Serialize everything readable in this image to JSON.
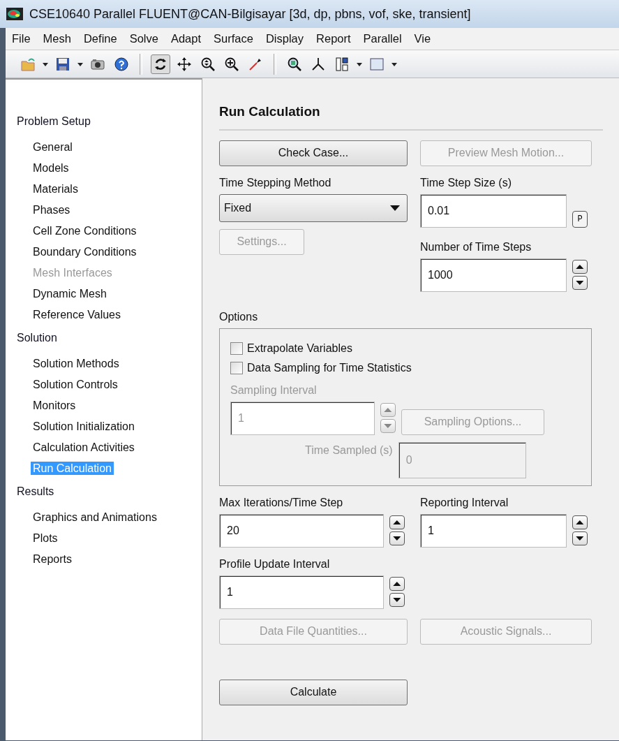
{
  "window": {
    "title": "CSE10640 Parallel FLUENT@CAN-Bilgisayar  [3d, dp, pbns, vof, ske, transient]"
  },
  "menu_bar": [
    "File",
    "Mesh",
    "Define",
    "Solve",
    "Adapt",
    "Surface",
    "Display",
    "Report",
    "Parallel",
    "Vie"
  ],
  "navigation": [
    {
      "label": "Problem Setup",
      "items": [
        {
          "label": "General",
          "disabled": false,
          "selected": false
        },
        {
          "label": "Models",
          "disabled": false,
          "selected": false
        },
        {
          "label": "Materials",
          "disabled": false,
          "selected": false
        },
        {
          "label": "Phases",
          "disabled": false,
          "selected": false
        },
        {
          "label": "Cell Zone Conditions",
          "disabled": false,
          "selected": false
        },
        {
          "label": "Boundary Conditions",
          "disabled": false,
          "selected": false
        },
        {
          "label": "Mesh Interfaces",
          "disabled": true,
          "selected": false
        },
        {
          "label": "Dynamic Mesh",
          "disabled": false,
          "selected": false
        },
        {
          "label": "Reference Values",
          "disabled": false,
          "selected": false
        }
      ]
    },
    {
      "label": "Solution",
      "items": [
        {
          "label": "Solution Methods",
          "disabled": false,
          "selected": false
        },
        {
          "label": "Solution Controls",
          "disabled": false,
          "selected": false
        },
        {
          "label": "Monitors",
          "disabled": false,
          "selected": false
        },
        {
          "label": "Solution Initialization",
          "disabled": false,
          "selected": false
        },
        {
          "label": "Calculation Activities",
          "disabled": false,
          "selected": false
        },
        {
          "label": "Run Calculation",
          "disabled": false,
          "selected": true
        }
      ]
    },
    {
      "label": "Results",
      "items": [
        {
          "label": "Graphics and Animations",
          "disabled": false,
          "selected": false
        },
        {
          "label": "Plots",
          "disabled": false,
          "selected": false
        },
        {
          "label": "Reports",
          "disabled": false,
          "selected": false
        }
      ]
    }
  ],
  "panel": {
    "title": "Run Calculation",
    "check_case_button": {
      "label": "Check Case...",
      "disabled": false
    },
    "preview_mesh_motion_button": {
      "label": "Preview Mesh Motion...",
      "disabled": true
    },
    "time_stepping_method": {
      "label": "Time Stepping Method",
      "value": "Fixed"
    },
    "settings_button": {
      "label": "Settings...",
      "disabled": true
    },
    "time_step_size": {
      "label": "Time Step Size (s)",
      "value": "0.01",
      "parameter_button": "P"
    },
    "number_of_time_steps": {
      "label": "Number of Time Steps",
      "value": "1000",
      "disabled": false
    },
    "options": {
      "label": "Options",
      "checkboxes": [
        {
          "label": "Extrapolate Variables",
          "checked": false
        },
        {
          "label": "Data Sampling for Time Statistics",
          "checked": false
        }
      ],
      "sampling_interval": {
        "label": "Sampling Interval",
        "value": "1",
        "disabled": true
      },
      "sampling_options_button": {
        "label": "Sampling Options...",
        "disabled": true
      },
      "time_sampled": {
        "label": "Time Sampled (s)",
        "value": "0",
        "disabled": true
      }
    },
    "max_iterations_per_time_step": {
      "label": "Max Iterations/Time Step",
      "value": "20",
      "disabled": false
    },
    "reporting_interval": {
      "label": "Reporting Interval",
      "value": "1",
      "disabled": false
    },
    "profile_update_interval": {
      "label": "Profile Update Interval",
      "value": "1",
      "disabled": false
    },
    "data_file_quantities_button": {
      "label": "Data File Quantities...",
      "disabled": true
    },
    "acoustic_signals_button": {
      "label": "Acoustic Signals...",
      "disabled": true
    },
    "calculate_button": {
      "label": "Calculate",
      "disabled": false
    }
  }
}
